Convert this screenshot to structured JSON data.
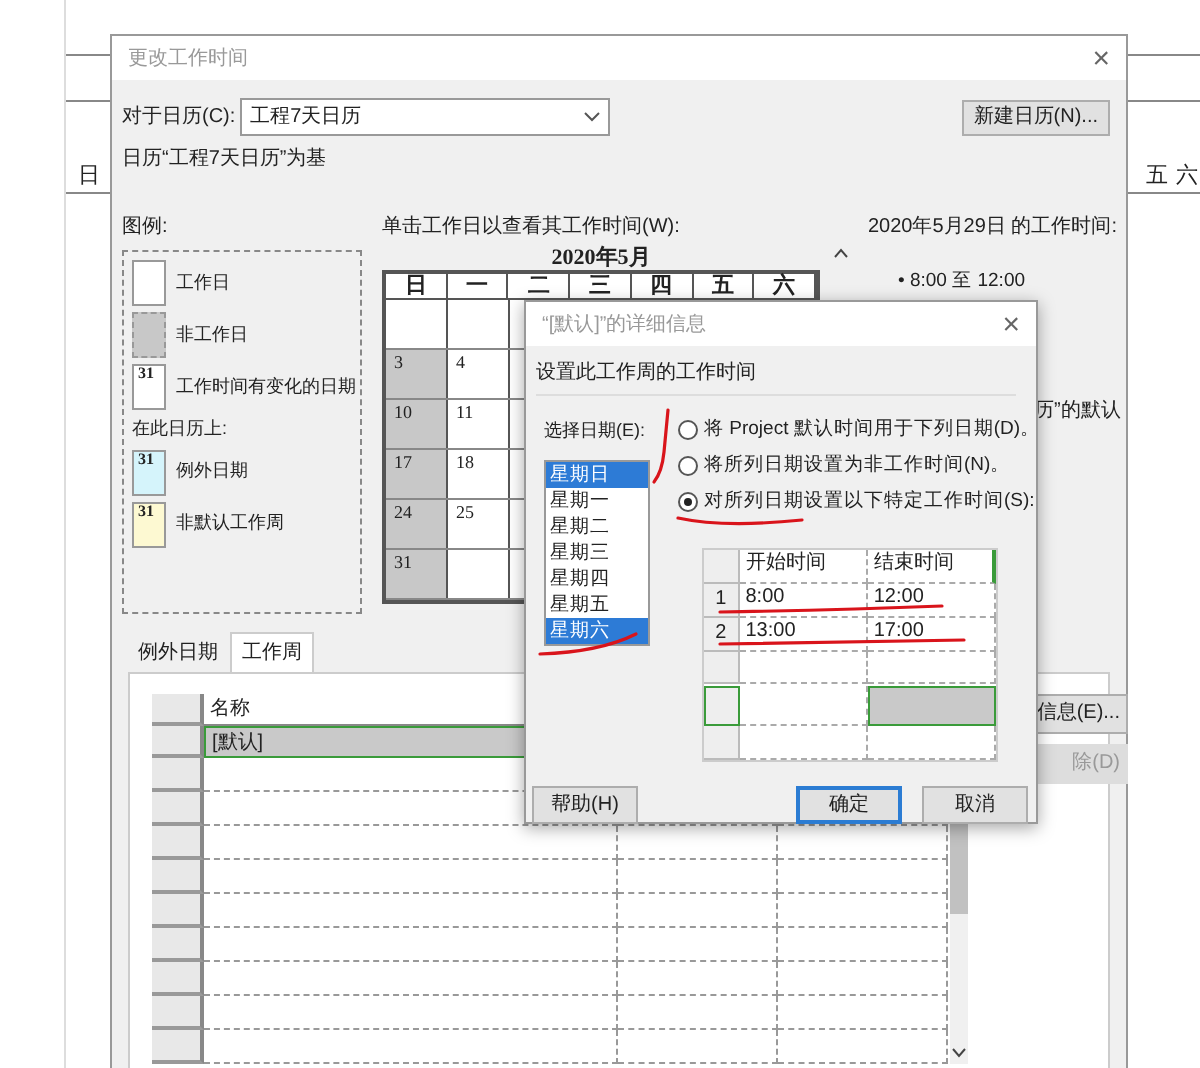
{
  "background_app": {
    "left_texts": [
      "日"
    ],
    "right_texts": [
      "五",
      "六"
    ]
  },
  "window": {
    "title": "更改工作时间",
    "close": "×"
  },
  "calendar_select": {
    "label": "对于日历(C):",
    "value": "工程7天日历"
  },
  "new_calendar_button": "新建日历(N)...",
  "based_on": "日历“工程7天日历”为基",
  "legend": {
    "title": "图例:",
    "items": [
      {
        "kind": "working",
        "label": "工作日"
      },
      {
        "kind": "nonworking",
        "label": "非工作日"
      },
      {
        "kind": "changed",
        "label": "工作时间有变化的日期",
        "date": "31"
      },
      {
        "kind": "heading",
        "label": "在此日历上:"
      },
      {
        "kind": "exception",
        "label": "例外日期",
        "date": "31"
      },
      {
        "kind": "nondefault",
        "label": "非默认工作周",
        "date": "31"
      }
    ]
  },
  "calendar": {
    "instruction": "单击工作日以查看其工作时间(W):",
    "month": "2020年5月",
    "weekdays": [
      "日",
      "一",
      "二",
      "三",
      "四",
      "五",
      "六"
    ],
    "weeks": [
      [
        {
          "nonworking": false
        },
        {
          "nonworking": false
        }
      ],
      [
        {
          "day": "3",
          "nonworking": true
        },
        {
          "day": "4",
          "nonworking": false
        }
      ],
      [
        {
          "day": "10",
          "nonworking": true
        },
        {
          "day": "11",
          "nonworking": false
        }
      ],
      [
        {
          "day": "17",
          "nonworking": true
        },
        {
          "day": "18",
          "nonworking": false
        }
      ],
      [
        {
          "day": "24",
          "nonworking": true
        },
        {
          "day": "25",
          "nonworking": false
        }
      ],
      [
        {
          "day": "31",
          "nonworking": true
        },
        {
          "nonworking": false
        }
      ]
    ]
  },
  "work_times": {
    "title": "2020年5月29日 的工作时间:",
    "items": [
      "• 8:00 至 12:00"
    ],
    "partial_text": "历”的默认"
  },
  "tabs": [
    {
      "label": "例外日期",
      "selected": false
    },
    {
      "label": "工作周",
      "selected": true
    }
  ],
  "work_weeks_table": {
    "columns": [
      "名称"
    ],
    "rows": [
      {
        "name": "[默认]",
        "selected": true
      }
    ]
  },
  "side_buttons": [
    {
      "label": "信息(E)...",
      "disabled": false
    },
    {
      "label": "除(D)",
      "disabled": true
    }
  ],
  "details_dialog": {
    "title": "“[默认]”的详细信息",
    "close": "×",
    "section": "设置此工作周的工作时间",
    "select_label": "选择日期(E):",
    "days": [
      {
        "label": "星期日",
        "selected": true
      },
      {
        "label": "星期一",
        "selected": false
      },
      {
        "label": "星期二",
        "selected": false
      },
      {
        "label": "星期三",
        "selected": false
      },
      {
        "label": "星期四",
        "selected": false
      },
      {
        "label": "星期五",
        "selected": false
      },
      {
        "label": "星期六",
        "selected": true
      }
    ],
    "options": [
      {
        "label": "将 Project 默认时间用于下列日期(D)。",
        "selected": false
      },
      {
        "label": "将所列日期设置为非工作时间(N)。",
        "selected": false
      },
      {
        "label": "对所列日期设置以下特定工作时间(S):",
        "selected": true
      }
    ],
    "times_table": {
      "columns": [
        "开始时间",
        "结束时间"
      ],
      "rows": [
        {
          "index": "1",
          "start": "8:00",
          "end": "12:00"
        },
        {
          "index": "2",
          "start": "13:00",
          "end": "17:00"
        }
      ]
    },
    "buttons": [
      {
        "label": "帮助(H)",
        "default": false
      },
      {
        "label": "确定",
        "default": true
      },
      {
        "label": "取消",
        "default": false
      }
    ]
  }
}
